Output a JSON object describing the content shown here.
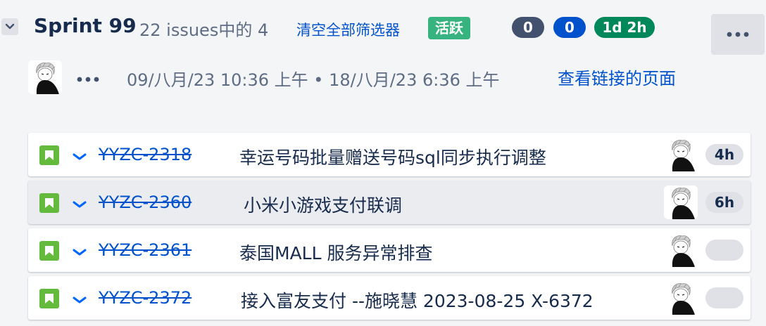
{
  "sprint": {
    "name": "Sprint 99",
    "issue_count_text": "22 issues中的 4",
    "clear_filters_label": "清空全部筛选器",
    "status_label": "活跃",
    "badges": {
      "todo": "0",
      "in_progress": "0",
      "time": "1d 2h"
    },
    "dates": "09/八月/23 10:36 上午 • 18/八月/23 6:36 上午",
    "view_linked_pages": "查看链接的页面"
  },
  "issues": [
    {
      "key": "YYZC-2318",
      "summary": "幸运号码批量赠送号码sql同步执行调整",
      "estimate": "4h",
      "selected": false
    },
    {
      "key": "YYZC-2360",
      "summary": "小米小游戏支付联调",
      "estimate": "6h",
      "selected": true
    },
    {
      "key": "YYZC-2361",
      "summary": "泰国MALL 服务异常排查",
      "estimate": "",
      "selected": false
    },
    {
      "key": "YYZC-2372",
      "summary": "接入富友支付 --施晓慧 2023-08-25 X-6372",
      "estimate": "",
      "selected": false
    }
  ],
  "icons": {
    "collapse": "chevron-down-icon",
    "more": "more-dots-icon",
    "issue_type": "story-icon",
    "priority": "priority-low-icon",
    "avatar": "user-avatar-icon"
  },
  "colors": {
    "link": "#0052cc",
    "active": "#36b37e",
    "badge_todo": "#42526e",
    "badge_progress": "#0052cc",
    "badge_time": "#00875a",
    "story": "#63ba3c"
  }
}
